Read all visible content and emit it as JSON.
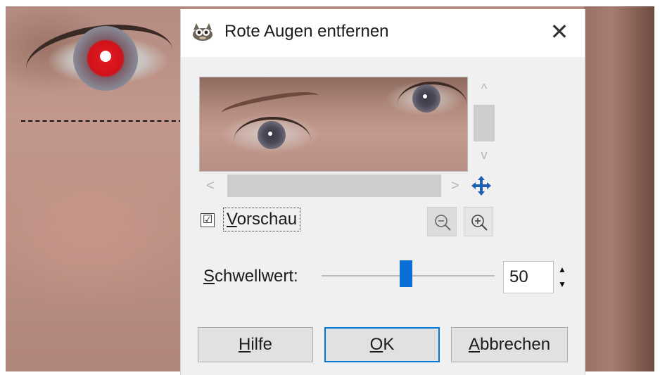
{
  "dialog": {
    "title": "Rote Augen entfernen",
    "close_symbol": "✕",
    "icon": "gimp-wilber-icon"
  },
  "preview": {
    "checkbox_checked": true,
    "checkbox_symbol": "☑",
    "label_mnemonic": "V",
    "label_rest": "orschau",
    "scroll_up": "^",
    "scroll_down": "v",
    "scroll_left": "<",
    "scroll_right": ">",
    "navigate_icon": "move-arrows-icon",
    "zoom_out_icon": "zoom-out-icon",
    "zoom_in_icon": "zoom-in-icon"
  },
  "threshold": {
    "label_mnemonic": "S",
    "label_rest": "chwellwert:",
    "value": "50",
    "slider_fraction": 0.5
  },
  "buttons": {
    "help_mnemonic": "H",
    "help_rest": "ilfe",
    "ok_mnemonic": "O",
    "ok_rest": "K",
    "cancel_mnemonic": "A",
    "cancel_rest": "bbrechen"
  },
  "colors": {
    "accent": "#0078d7",
    "slider": "#0a6fd6",
    "red_eye": "#e21b23"
  }
}
